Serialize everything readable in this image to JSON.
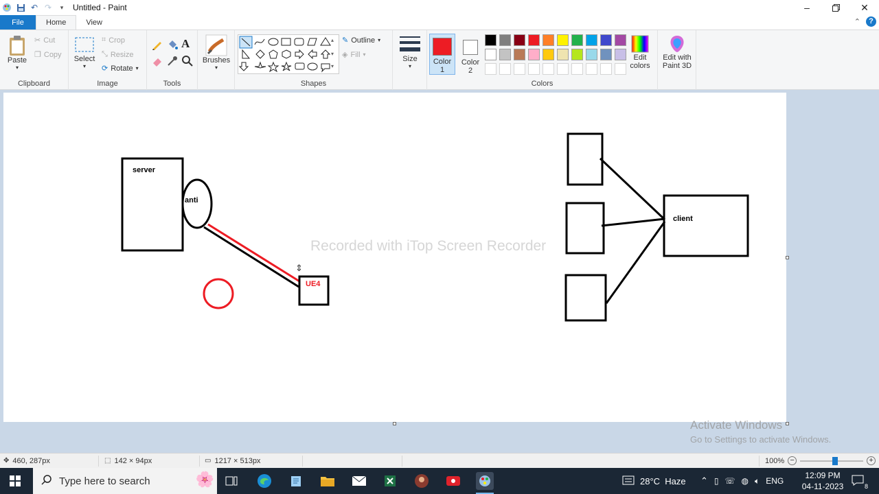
{
  "window": {
    "title": "Untitled - Paint"
  },
  "quick_access": [
    "app-icon",
    "save-icon",
    "undo-icon",
    "redo-icon",
    "dropdown-icon"
  ],
  "tabs": {
    "file": "File",
    "home": "Home",
    "view": "View"
  },
  "ribbon": {
    "clipboard": {
      "paste": "Paste",
      "cut": "Cut",
      "copy": "Copy",
      "label": "Clipboard"
    },
    "image": {
      "select": "Select",
      "crop": "Crop",
      "resize": "Resize",
      "rotate": "Rotate",
      "label": "Image"
    },
    "tools": {
      "label": "Tools"
    },
    "brushes": {
      "label": "Brushes"
    },
    "shapes": {
      "outline": "Outline",
      "fill": "Fill",
      "label": "Shapes"
    },
    "size": {
      "label": "Size"
    },
    "colors": {
      "color1": "Color",
      "color1_num": "1",
      "color2": "Color",
      "color2_num": "2",
      "color1_value": "#ed1c24",
      "color2_value": "#ffffff",
      "edit_colors": "Edit colors",
      "edit_3d": "Edit with Paint 3D",
      "label": "Colors",
      "palette_row1": [
        "#000000",
        "#7f7f7f",
        "#880015",
        "#ed1c24",
        "#ff7f27",
        "#fff200",
        "#22b14c",
        "#00a2e8",
        "#3f48cc",
        "#a349a4"
      ],
      "palette_row2": [
        "#ffffff",
        "#c3c3c3",
        "#b97a57",
        "#ffaec9",
        "#ffc90e",
        "#efe4b0",
        "#b5e61d",
        "#99d9ea",
        "#7092be",
        "#c8bfe7"
      ]
    }
  },
  "drawing": {
    "server_label": "server",
    "anti_label": "anti",
    "ue4_label": "UE4",
    "client_label": "client",
    "stroke_color": "#000000",
    "accent_color": "#ed1c24"
  },
  "watermark": "Recorded with iTop Screen Recorder",
  "activation": {
    "line1": "Activate Windows",
    "line2": "Go to Settings to activate Windows."
  },
  "statusbar": {
    "cursor_pos": "460, 287px",
    "selection_size": "142 × 94px",
    "canvas_size": "1217 × 513px",
    "zoom": "100%",
    "zoom_level": 0.55
  },
  "taskbar": {
    "search_placeholder": "Type here to search",
    "weather": "28°C  Haze",
    "language": "ENG",
    "time": "12:09 PM",
    "date": "04-11-2023",
    "notifications": "8"
  }
}
